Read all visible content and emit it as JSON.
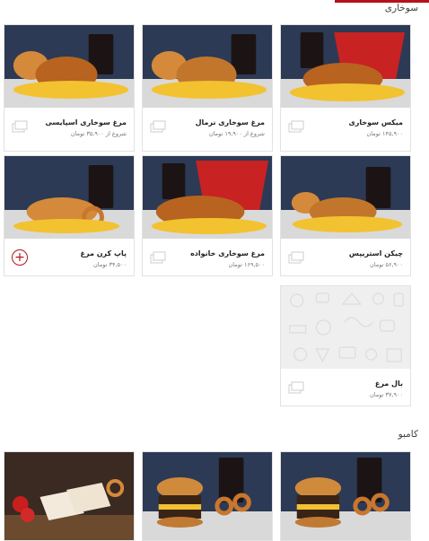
{
  "sections": {
    "fried": {
      "title": "سوخاری"
    },
    "combo": {
      "title": "کامبو"
    }
  },
  "products": [
    {
      "name": "مرغ سوخاری اسپایسی",
      "price": "شروع از ۳۵,۹۰۰ تومان"
    },
    {
      "name": "مرغ سوخاری نرمال",
      "price": "شروع از ۱۹,۹۰۰ تومان"
    },
    {
      "name": "میکس سوخاری",
      "price": "۱۴۵,۹۰۰ تومان"
    },
    {
      "name": "پاپ کرن مرغ",
      "price": "۳۴,۵۰۰ تومان"
    },
    {
      "name": "مرغ سوخاری خانواده",
      "price": "۱۶۹,۵۰۰ تومان"
    },
    {
      "name": "چیکن استریپس",
      "price": "۵۶,۹۰۰ تومان"
    },
    {
      "name": "بال مرغ",
      "price": "۳۷,۹۰۰ تومان"
    }
  ],
  "icons": {
    "add": "plus-circle-icon",
    "stack": "stacked-cards-icon"
  },
  "colors": {
    "accent": "#b5121b"
  }
}
